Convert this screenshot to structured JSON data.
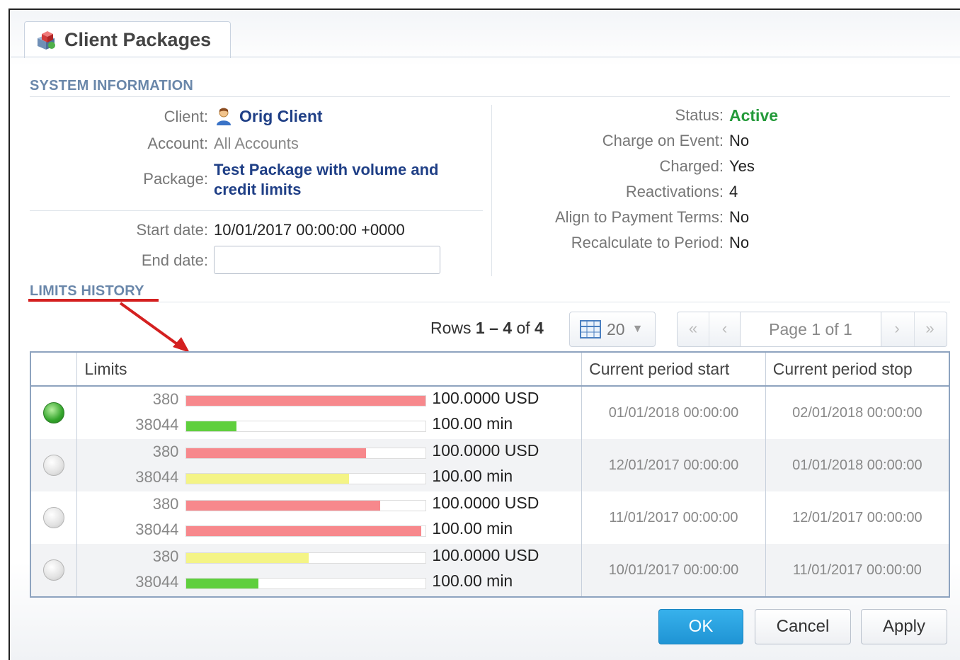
{
  "tab": {
    "title": "Client Packages",
    "icon": "packages-icon"
  },
  "system_info": {
    "title": "SYSTEM INFORMATION",
    "client_label": "Client:",
    "client_value": "Orig Client",
    "account_label": "Account:",
    "account_value": "All Accounts",
    "package_label": "Package:",
    "package_value_line1": "Test Package with volume and",
    "package_value_line2": "credit limits",
    "start_label": "Start date:",
    "start_value": "10/01/2017 00:00:00 +0000",
    "end_label": "End date:",
    "end_value": "",
    "status_label": "Status:",
    "status_value": "Active",
    "charge_event_label": "Charge on Event:",
    "charge_event_value": "No",
    "charged_label": "Charged:",
    "charged_value": "Yes",
    "reactivations_label": "Reactivations:",
    "reactivations_value": "4",
    "align_label": "Align to Payment Terms:",
    "align_value": "No",
    "recalc_label": "Recalculate to Period:",
    "recalc_value": "No"
  },
  "limits_history": {
    "title": "LIMITS HISTORY",
    "rows_prefix": "Rows ",
    "rows_range": "1 – 4",
    "rows_of": " of ",
    "rows_total": "4",
    "per_page": "20",
    "page_text": "Page 1 of 1",
    "pager": {
      "first": "«",
      "prev": "‹",
      "next": "›",
      "last": "»"
    },
    "columns": {
      "status": "",
      "limits": "Limits",
      "start": "Current period start",
      "stop": "Current period stop"
    },
    "rows": [
      {
        "active": true,
        "limits": [
          {
            "num": "380",
            "amount": "100.0000 USD",
            "fill": 1.0,
            "color": "#f7888c"
          },
          {
            "num": "38044",
            "amount": "100.00 min",
            "fill": 0.21,
            "color": "#5fcf3d"
          }
        ],
        "start": "01/01/2018 00:00:00",
        "stop": "02/01/2018 00:00:00"
      },
      {
        "active": false,
        "limits": [
          {
            "num": "380",
            "amount": "100.0000 USD",
            "fill": 0.75,
            "color": "#f7888c"
          },
          {
            "num": "38044",
            "amount": "100.00 min",
            "fill": 0.68,
            "color": "#f4f486"
          }
        ],
        "start": "12/01/2017 00:00:00",
        "stop": "01/01/2018 00:00:00"
      },
      {
        "active": false,
        "limits": [
          {
            "num": "380",
            "amount": "100.0000 USD",
            "fill": 0.81,
            "color": "#f7888c"
          },
          {
            "num": "38044",
            "amount": "100.00 min",
            "fill": 0.98,
            "color": "#f7888c"
          }
        ],
        "start": "11/01/2017 00:00:00",
        "stop": "12/01/2017 00:00:00"
      },
      {
        "active": false,
        "limits": [
          {
            "num": "380",
            "amount": "100.0000 USD",
            "fill": 0.51,
            "color": "#f4f486"
          },
          {
            "num": "38044",
            "amount": "100.00 min",
            "fill": 0.3,
            "color": "#5fcf3d"
          }
        ],
        "start": "10/01/2017 00:00:00",
        "stop": "11/01/2017 00:00:00"
      }
    ]
  },
  "buttons": {
    "ok": "OK",
    "cancel": "Cancel",
    "apply": "Apply"
  }
}
